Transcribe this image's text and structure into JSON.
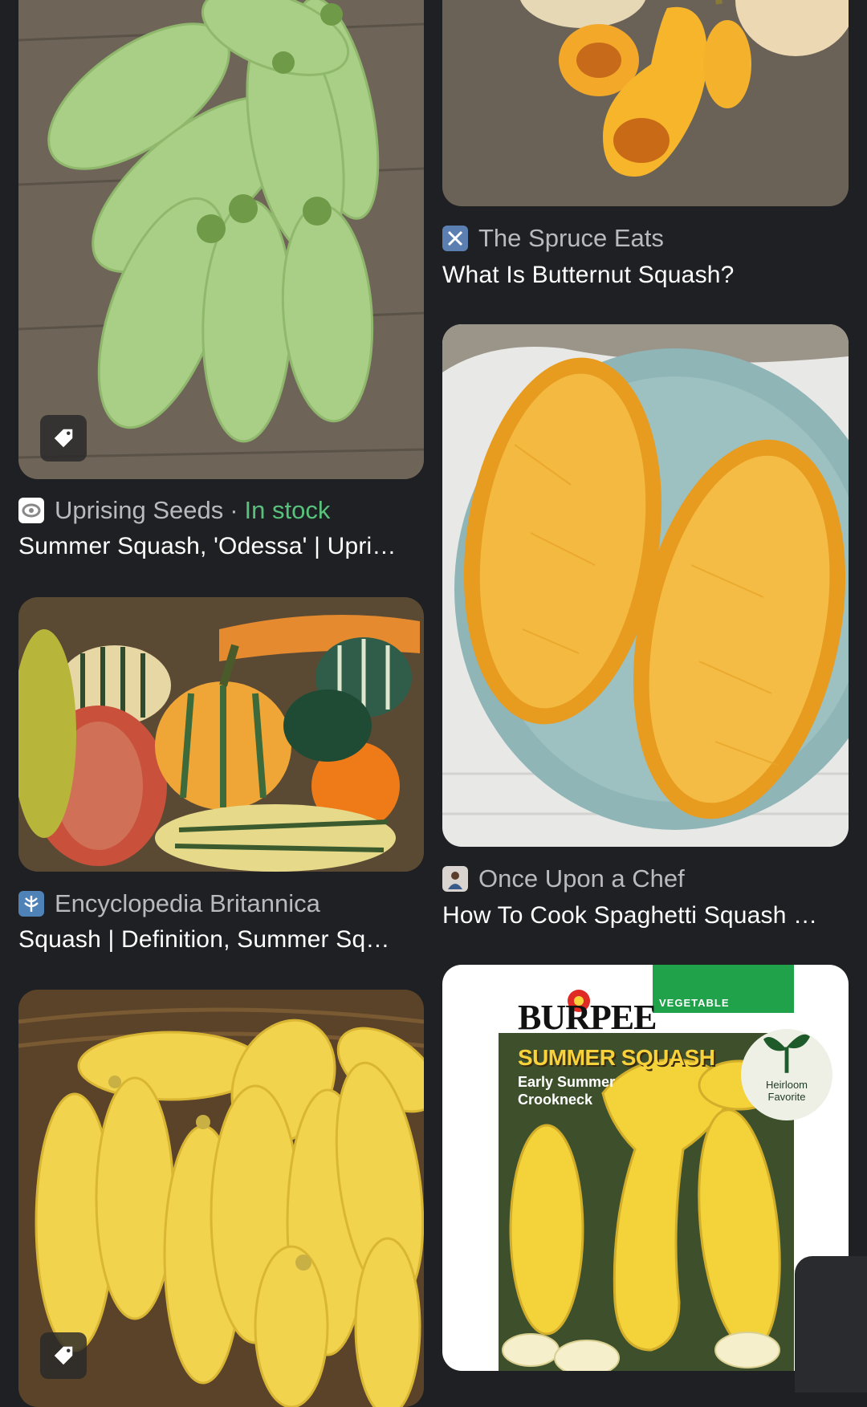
{
  "results": [
    {
      "id": "odessa",
      "source": "Uprising Seeds",
      "stock": "In stock",
      "separator": "·",
      "title": "Summer Squash, 'Odessa' | Upri…",
      "favicon": "uprising-seeds-favicon",
      "has_tag": true
    },
    {
      "id": "butternut",
      "source": "The Spruce Eats",
      "title": "What Is Butternut Squash?",
      "favicon": "spruce-eats-favicon"
    },
    {
      "id": "britannica",
      "source": "Encyclopedia Britannica",
      "title": "Squash | Definition, Summer Sq…",
      "favicon": "britannica-favicon"
    },
    {
      "id": "spaghetti",
      "source": "Once Upon a Chef",
      "title": "How To Cook Spaghetti Squash …",
      "favicon": "once-upon-a-chef-favicon"
    },
    {
      "id": "yellow",
      "has_tag": true
    },
    {
      "id": "burpee",
      "packet": {
        "brand": "BURPEE",
        "category": "VEGETABLE",
        "name": "SUMMER SQUASH",
        "variety_line1": "Early Summer",
        "variety_line2": "Crookneck",
        "badge_line1": "Heirloom",
        "badge_line2": "Favorite"
      }
    }
  ],
  "colors": {
    "background": "#1f2023",
    "source_text": "#b9babd",
    "title_text": "#ffffff",
    "in_stock": "#58c27d"
  }
}
